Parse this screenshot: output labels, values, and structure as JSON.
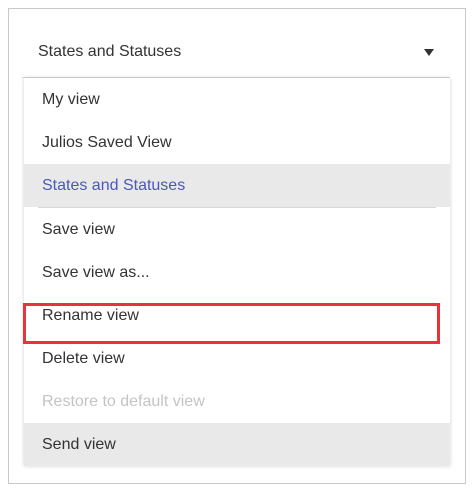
{
  "selector": {
    "label": "States and Statuses"
  },
  "menu": {
    "views": [
      {
        "label": "My view"
      },
      {
        "label": "Julios Saved View"
      },
      {
        "label": "States and Statuses"
      }
    ],
    "actions": {
      "save": "Save view",
      "save_as": "Save view as...",
      "rename": "Rename view",
      "delete": "Delete view",
      "restore": "Restore to default view",
      "send": "Send view"
    }
  },
  "colors": {
    "selected_text": "#4a59b6",
    "highlight_border": "#e8333d",
    "disabled_text": "#c4c4c4"
  }
}
